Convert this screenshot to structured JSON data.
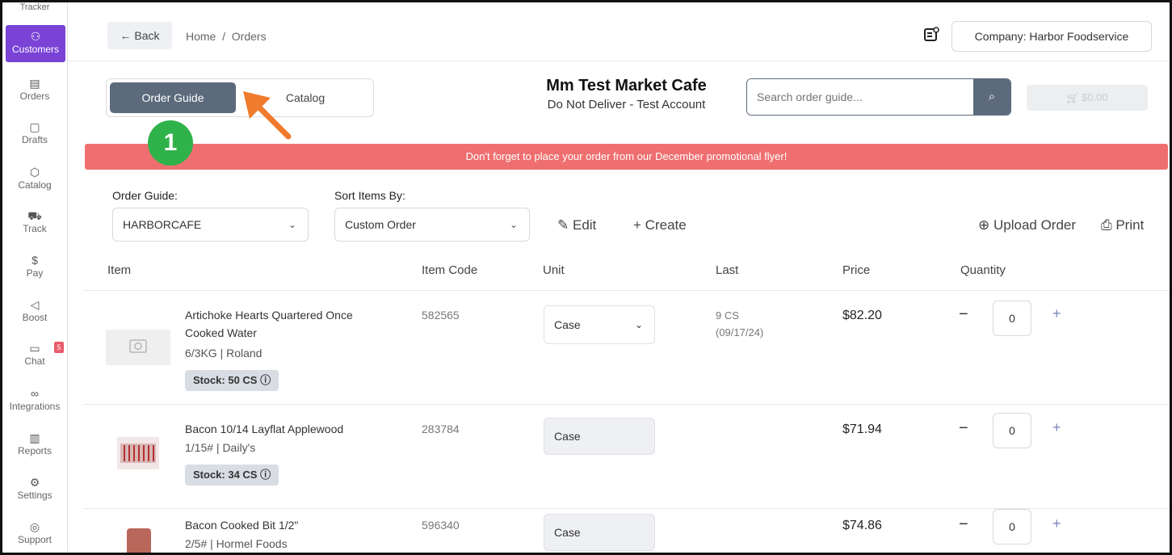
{
  "sidebar": {
    "items": [
      {
        "label": "Tracker",
        "icon": "tracker-icon",
        "glyph": ""
      },
      {
        "label": "Customers",
        "icon": "users-icon",
        "glyph": "⚇"
      },
      {
        "label": "Orders",
        "icon": "document-icon",
        "glyph": "▤"
      },
      {
        "label": "Drafts",
        "icon": "draft-icon",
        "glyph": "▢"
      },
      {
        "label": "Catalog",
        "icon": "box-icon",
        "glyph": "⬡"
      },
      {
        "label": "Track",
        "icon": "truck-icon",
        "glyph": "⛟"
      },
      {
        "label": "Pay",
        "icon": "dollar-icon",
        "glyph": "$"
      },
      {
        "label": "Boost",
        "icon": "megaphone-icon",
        "glyph": "◁"
      },
      {
        "label": "Chat",
        "icon": "chat-icon",
        "glyph": "▭",
        "badge": "5"
      },
      {
        "label": "Integrations",
        "icon": "link-icon",
        "glyph": "∞"
      },
      {
        "label": "Reports",
        "icon": "reports-icon",
        "glyph": "▥"
      },
      {
        "label": "Settings",
        "icon": "gear-icon",
        "glyph": "⚙"
      },
      {
        "label": "Support",
        "icon": "support-icon",
        "glyph": "◎"
      }
    ]
  },
  "header": {
    "back_label": "Back",
    "back_glyph": "←",
    "breadcrumb": "Home  /  Orders",
    "company_label": "Company:  Harbor Foodservice"
  },
  "toggle": {
    "order_guide": "Order Guide",
    "catalog": "Catalog"
  },
  "callout_number": "1",
  "customer": {
    "name": "Mm Test Market Cafe",
    "subtitle": "Do Not Deliver - Test Account"
  },
  "search": {
    "placeholder": "Search order guide...",
    "button_glyph": "⌕"
  },
  "cart": {
    "glyph": "🛒",
    "total": "$0.00"
  },
  "promo_banner": "Don't forget to place your order from our December promotional flyer!",
  "controls": {
    "order_guide_label": "Order Guide:",
    "order_guide_value": "HARBORCAFE",
    "sort_label": "Sort Items By:",
    "sort_value": "Custom Order",
    "edit_label": "Edit",
    "edit_glyph": "✎",
    "create_label": "Create",
    "create_glyph": "+",
    "upload_label": "Upload Order",
    "upload_glyph": "⊕",
    "print_label": "Print",
    "print_glyph": "⎙",
    "chevron": "⌄"
  },
  "table": {
    "headers": {
      "item": "Item",
      "item_code": "Item Code",
      "unit": "Unit",
      "last": "Last",
      "price": "Price",
      "quantity": "Quantity"
    },
    "rows": [
      {
        "name_line1": "Artichoke Hearts Quartered Once",
        "name_line2": "Cooked Water",
        "detail": "6/3KG | Roland",
        "stock": "Stock: 50 CS",
        "code": "582565",
        "unit": "Case",
        "last_qty": "9 CS",
        "last_date": "(09/17/24)",
        "price": "$82.20",
        "quantity": "0"
      },
      {
        "name_line1": "Bacon 10/14 Layflat Applewood",
        "detail": "1/15# | Daily's",
        "stock": "Stock: 34 CS",
        "code": "283784",
        "unit": "Case",
        "price": "$71.94",
        "quantity": "0"
      },
      {
        "name_line1": "Bacon Cooked Bit 1/2\"",
        "detail": "2/5# | Hormel Foods",
        "code": "596340",
        "unit": "Case",
        "price": "$74.86",
        "quantity": "0"
      }
    ],
    "minus_glyph": "−",
    "plus_glyph": "+",
    "info_glyph": "ⓘ"
  }
}
